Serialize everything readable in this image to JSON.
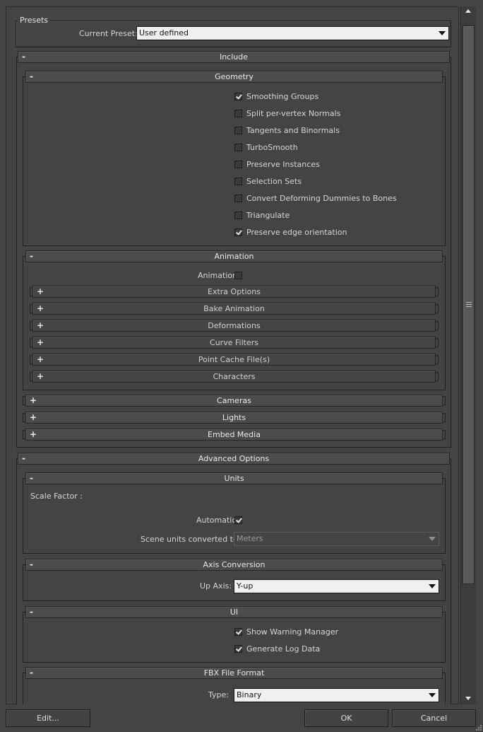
{
  "presets": {
    "group_title": "Presets",
    "current_preset_label": "Current Preset:",
    "current_preset_value": "User defined"
  },
  "include": {
    "sign": "-",
    "title": "Include",
    "geometry": {
      "sign": "-",
      "title": "Geometry",
      "options": [
        {
          "label": "Smoothing Groups",
          "checked": true
        },
        {
          "label": "Split per-vertex Normals",
          "checked": false
        },
        {
          "label": "Tangents and Binormals",
          "checked": false
        },
        {
          "label": "TurboSmooth",
          "checked": false
        },
        {
          "label": "Preserve Instances",
          "checked": false
        },
        {
          "label": "Selection Sets",
          "checked": false
        },
        {
          "label": "Convert Deforming Dummies to Bones",
          "checked": false
        },
        {
          "label": "Triangulate",
          "checked": false
        },
        {
          "label": "Preserve edge orientation",
          "checked": true
        }
      ]
    },
    "animation": {
      "sign": "-",
      "title": "Animation",
      "checkbox_label": "Animation",
      "checked": false,
      "subrollouts": [
        {
          "sign": "+",
          "title": "Extra Options"
        },
        {
          "sign": "+",
          "title": "Bake Animation"
        },
        {
          "sign": "+",
          "title": "Deformations"
        },
        {
          "sign": "+",
          "title": "Curve Filters"
        },
        {
          "sign": "+",
          "title": "Point Cache File(s)"
        },
        {
          "sign": "+",
          "title": "Characters"
        }
      ]
    },
    "collapsed": [
      {
        "sign": "+",
        "title": "Cameras"
      },
      {
        "sign": "+",
        "title": "Lights"
      },
      {
        "sign": "+",
        "title": "Embed Media"
      }
    ]
  },
  "advanced": {
    "sign": "-",
    "title": "Advanced Options",
    "units": {
      "sign": "-",
      "title": "Units",
      "scale_factor_label": "Scale Factor :",
      "automatic_label": "Automatic",
      "automatic_checked": true,
      "scene_units_label": "Scene units converted to:",
      "scene_units_value": "Meters"
    },
    "axis": {
      "sign": "-",
      "title": "Axis Conversion",
      "up_axis_label": "Up Axis:",
      "up_axis_value": "Y-up"
    },
    "ui": {
      "sign": "-",
      "title": "UI",
      "options": [
        {
          "label": "Show Warning Manager",
          "checked": true
        },
        {
          "label": "Generate Log Data",
          "checked": true
        }
      ]
    },
    "fbx": {
      "sign": "-",
      "title": "FBX File Format",
      "type_label": "Type:",
      "type_value": "Binary"
    }
  },
  "buttons": {
    "edit": "Edit...",
    "ok": "OK",
    "cancel": "Cancel"
  }
}
